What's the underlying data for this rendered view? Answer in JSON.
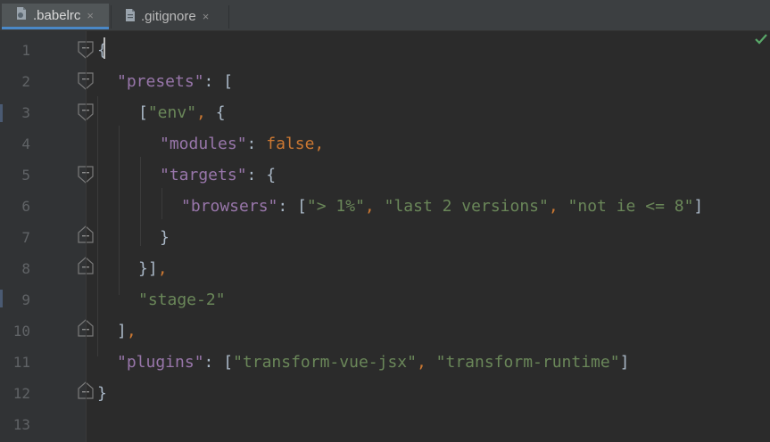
{
  "tabs": [
    {
      "label": ".babelrc",
      "icon": "babelrc-file-icon",
      "active": true,
      "close": "×"
    },
    {
      "label": ".gitignore",
      "icon": "gitignore-file-icon",
      "active": false,
      "close": "×"
    }
  ],
  "colors": {
    "background": "#2b2b2b",
    "gutter": "#313335",
    "key": "#9876aa",
    "string": "#6a8759",
    "keyword": "#cc7832",
    "text": "#a9b7c6",
    "line_number": "#606366",
    "active_tab_underline": "#4a88c7",
    "check": "#59a869"
  },
  "editor": {
    "status_icon": "inspection-ok-check-icon",
    "line_numbers": [
      "1",
      "2",
      "3",
      "4",
      "5",
      "6",
      "7",
      "8",
      "9",
      "10",
      "11",
      "12",
      "13"
    ],
    "lines": {
      "l1_open": "{",
      "l2_key": "\"presets\"",
      "l2_rest": ": [",
      "l3_open": "[",
      "l3_str": "\"env\"",
      "l3_comma": ",",
      "l3_rest": " {",
      "l4_key": "\"modules\"",
      "l4_colon": ": ",
      "l4_val": "false",
      "l4_comma": ",",
      "l5_key": "\"targets\"",
      "l5_rest": ": {",
      "l6_key": "\"browsers\"",
      "l6_colon": ": [",
      "l6_s1": "\"> 1%\"",
      "l6_c1": ", ",
      "l6_s2": "\"last 2 versions\"",
      "l6_c2": ", ",
      "l6_s3": "\"not ie <= 8\"",
      "l6_close": "]",
      "l7_close": "}",
      "l8_close": "}]",
      "l8_comma": ",",
      "l9_str": "\"stage-2\"",
      "l10_close": "]",
      "l10_comma": ",",
      "l11_key": "\"plugins\"",
      "l11_colon": ": [",
      "l11_s1": "\"transform-vue-jsx\"",
      "l11_c1": ", ",
      "l11_s2": "\"transform-runtime\"",
      "l11_close": "]",
      "l12_close": "}"
    }
  }
}
